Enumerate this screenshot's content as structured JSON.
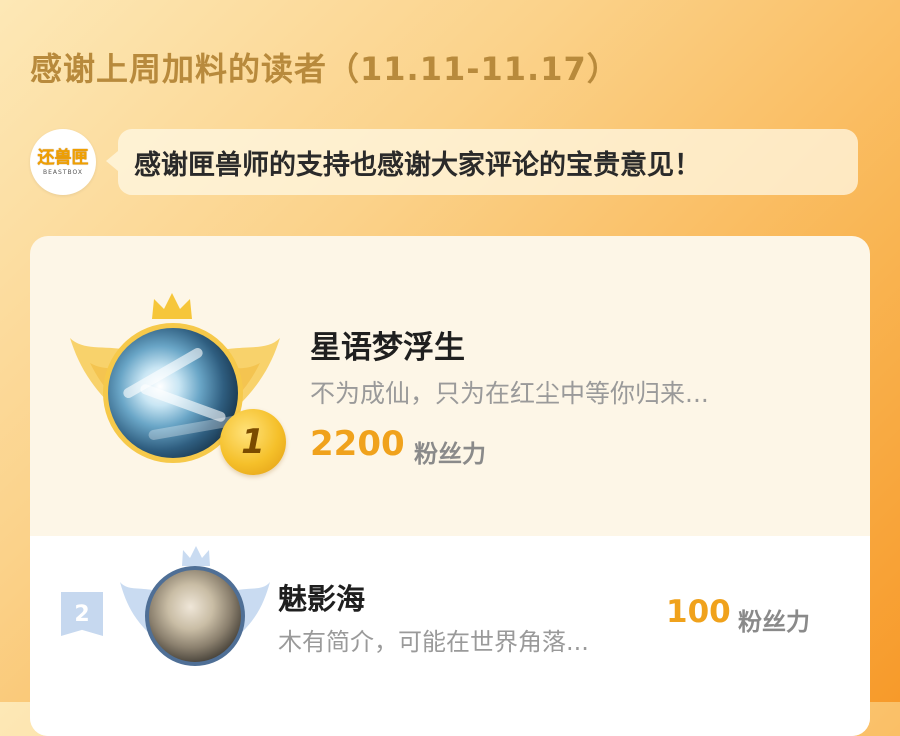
{
  "header": {
    "title": "感谢上周加料的读者（11.11-11.17）"
  },
  "author": {
    "logo_text": "还兽匣",
    "logo_subtext": "BEASTBOX",
    "message": "感谢匣兽师的支持也感谢大家评论的宝贵意见！"
  },
  "ranking": [
    {
      "rank": "1",
      "name": "星语梦浮生",
      "bio": "不为成仙，只为在红尘中等你归来...",
      "score": "2200",
      "unit": "粉丝力"
    },
    {
      "rank": "2",
      "name": "魅影海",
      "bio": "木有简介，可能在世界角落...",
      "score": "100",
      "unit": "粉丝力"
    }
  ],
  "colors": {
    "accent": "#f0a21c",
    "title": "#b88a3c",
    "gold": "#f6c94a",
    "silver": "#c6d8ef"
  }
}
